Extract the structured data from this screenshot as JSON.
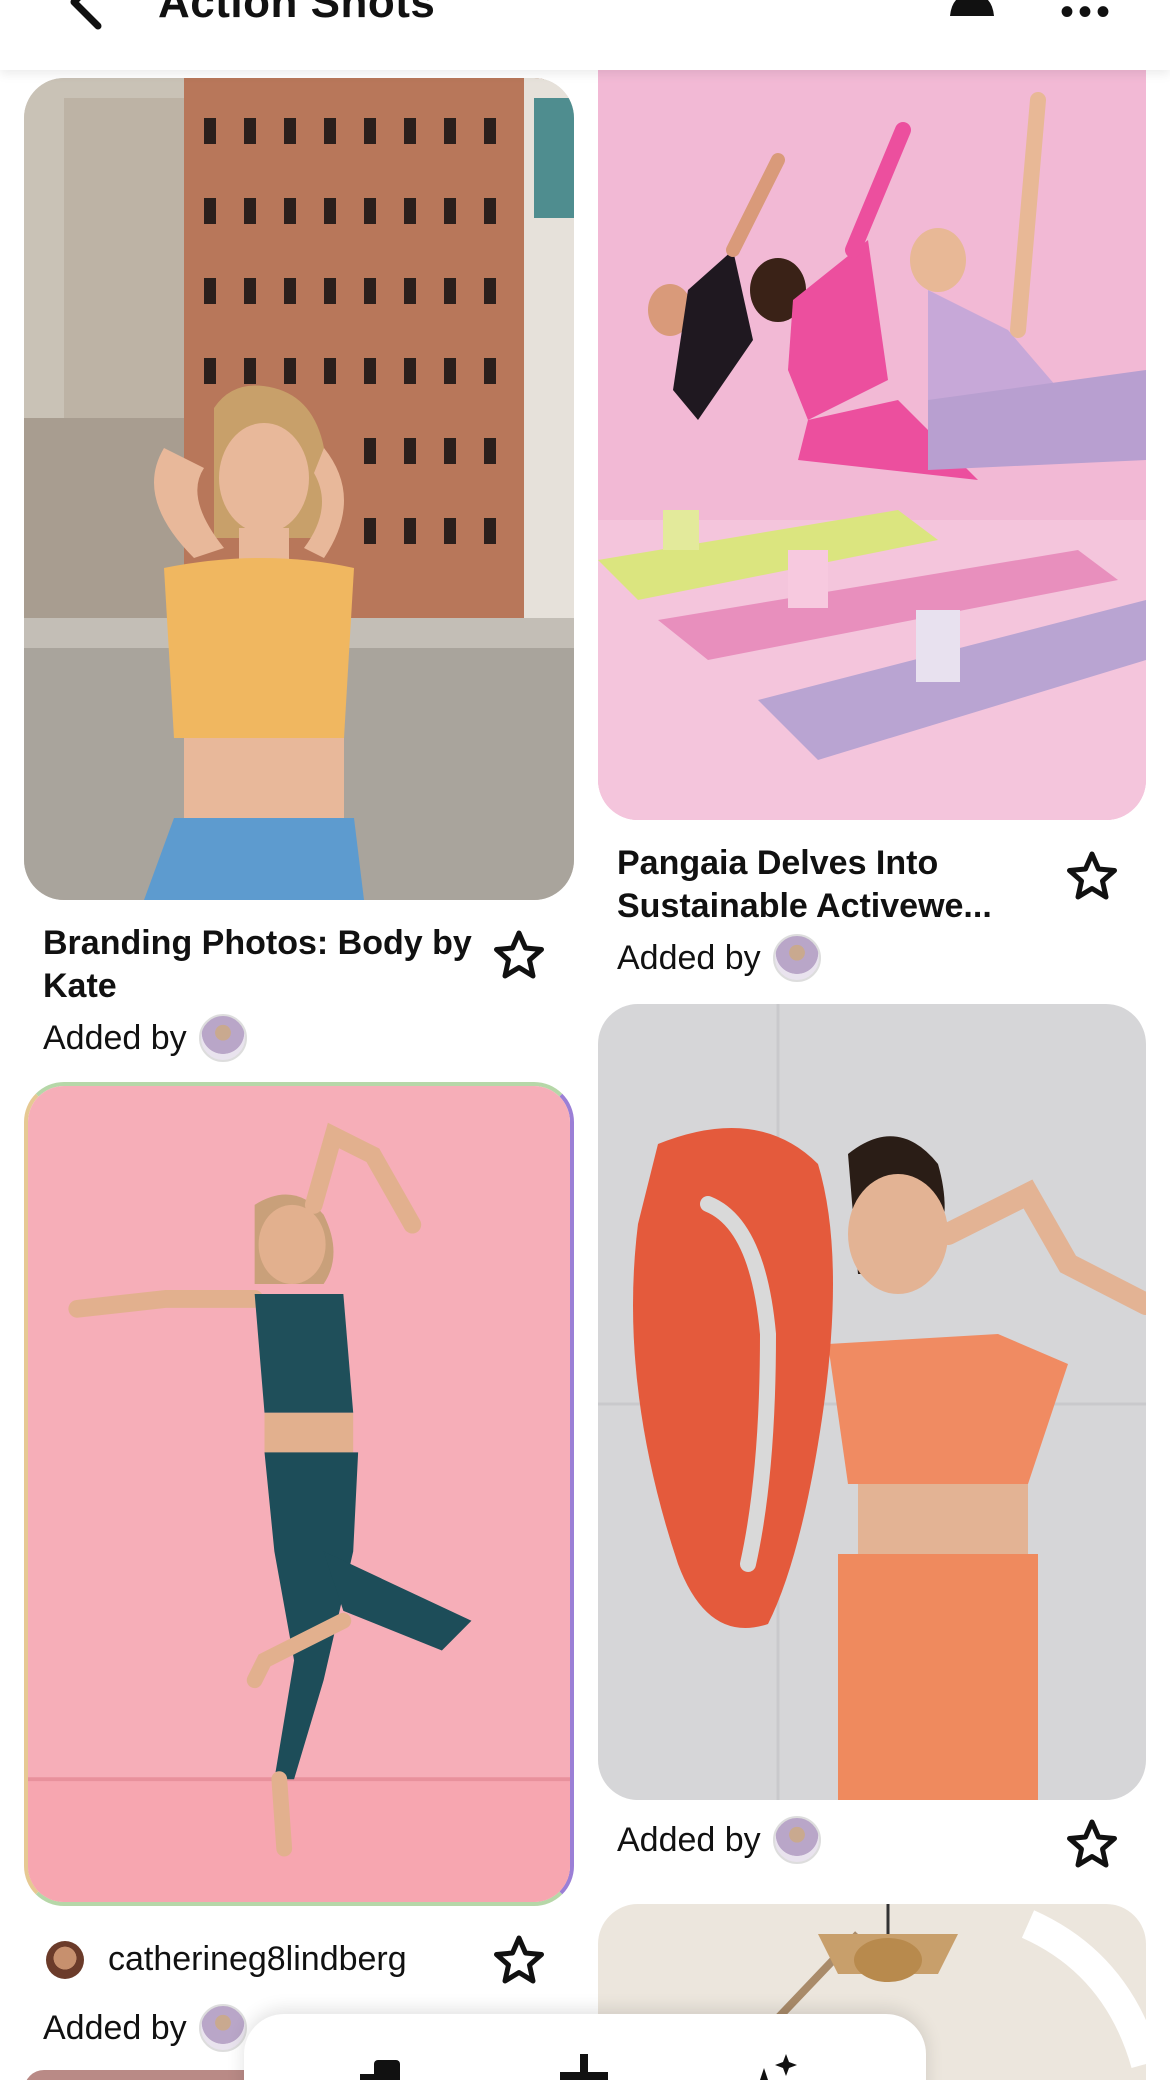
{
  "header": {
    "title": "Action Shots"
  },
  "pins": [
    {
      "title": "Branding Photos: Body by Kate",
      "added_by": "Added by",
      "image": "woman-rooftop-yellow-top"
    },
    {
      "title": "Pangaia Delves Into Sustainable Activewe...",
      "added_by": "Added by",
      "image": "three-women-yoga-pink"
    },
    {
      "creator": "catherineg8lindberg",
      "added_by": "Added by",
      "image": "woman-dancing-pink-wall"
    },
    {
      "title": "",
      "added_by": "Added by",
      "image": "woman-orange-sneaker"
    }
  ],
  "icons": {
    "back": "back-arrow-icon",
    "collaborators": "person-icon",
    "more": "more-icon",
    "star": "star-icon",
    "bottom_bar": [
      "organize-icon",
      "add-icon",
      "sparkle-icon"
    ]
  },
  "colors": {
    "text": "#111111",
    "background": "#ffffff"
  }
}
